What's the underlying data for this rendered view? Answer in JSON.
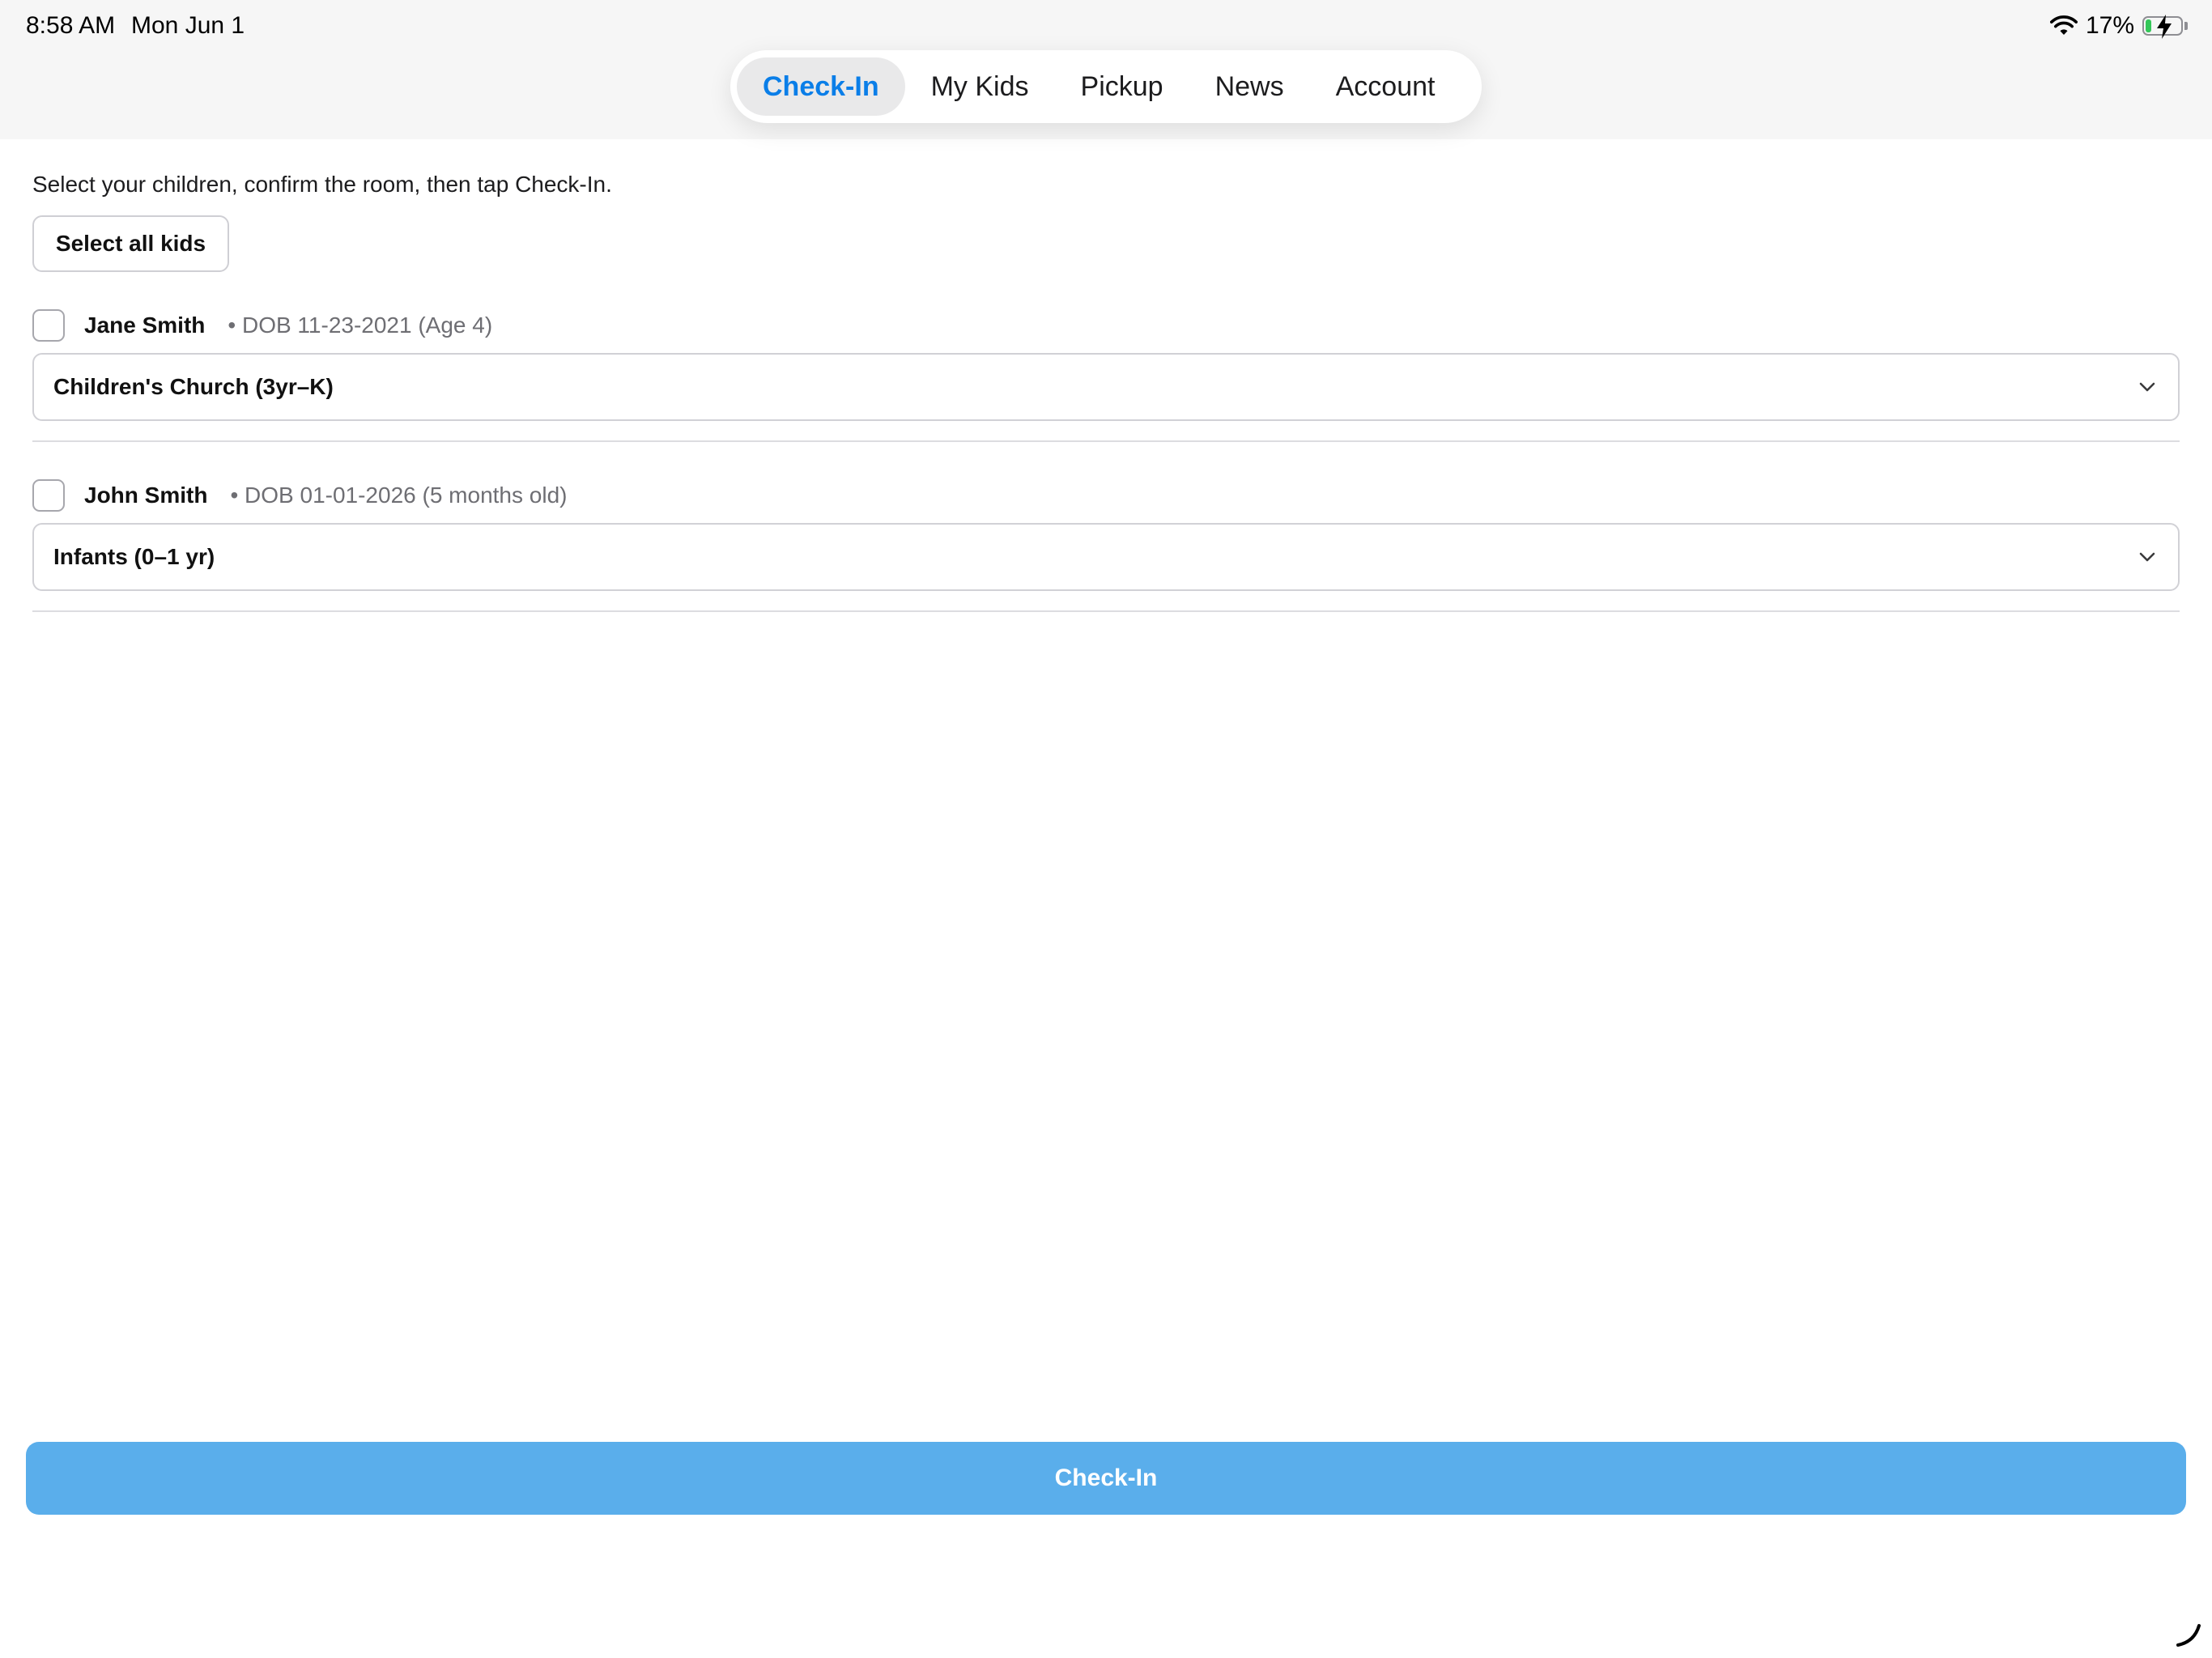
{
  "status_bar": {
    "time": "8:58 AM",
    "date": "Mon Jun 1",
    "battery_percent": "17%",
    "battery_level": 0.17,
    "icons": [
      "wifi-icon",
      "battery-charging-icon"
    ]
  },
  "tabs": [
    {
      "label": "Check-In",
      "active": true
    },
    {
      "label": "My Kids",
      "active": false
    },
    {
      "label": "Pickup",
      "active": false
    },
    {
      "label": "News",
      "active": false
    },
    {
      "label": "Account",
      "active": false
    }
  ],
  "checkin": {
    "instructions": "Select your children, confirm the room, then tap Check-In.",
    "select_all_label": "Select all kids",
    "kids": [
      {
        "name": "Jane Smith",
        "dob": "• DOB 11-23-2021 (Age 4)",
        "checked": false,
        "room": "Children's Church (3yr–K)"
      },
      {
        "name": "John Smith",
        "dob": "• DOB 01-01-2026 (5 months old)",
        "checked": false,
        "room": "Infants (0–1 yr)"
      }
    ],
    "submit_label": "Check-In"
  },
  "colors": {
    "accent": "#0a7ee8",
    "button": "#5aaeeb",
    "battery_fill": "#34c759"
  }
}
